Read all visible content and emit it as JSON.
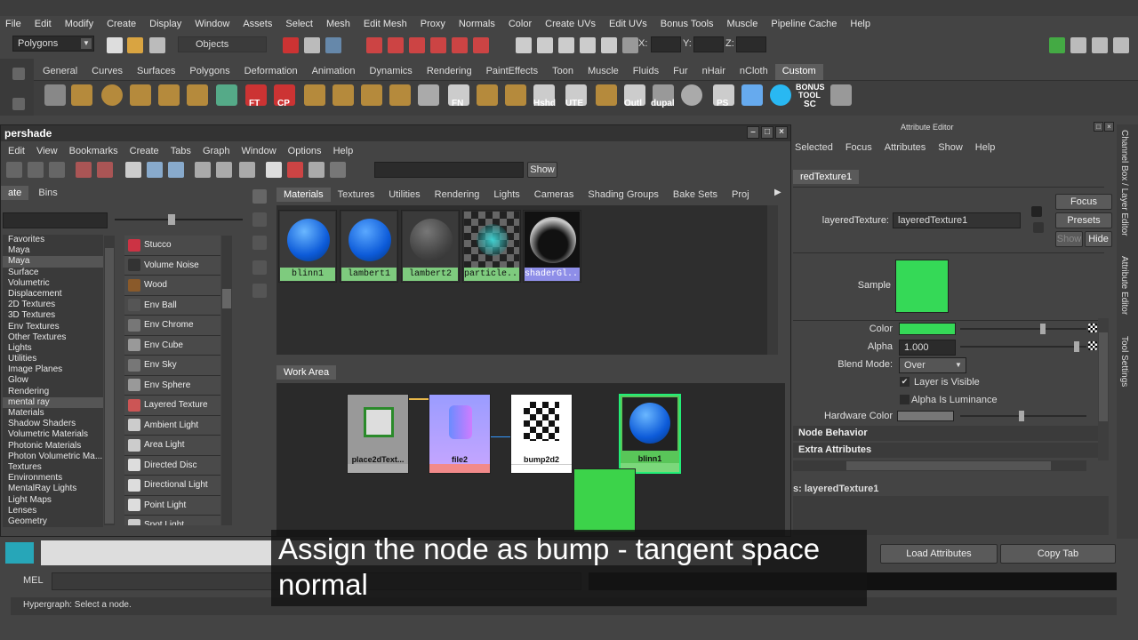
{
  "menu": [
    "File",
    "Edit",
    "Modify",
    "Create",
    "Display",
    "Window",
    "Assets",
    "Select",
    "Mesh",
    "Edit Mesh",
    "Proxy",
    "Normals",
    "Color",
    "Create UVs",
    "Edit UVs",
    "Bonus Tools",
    "Muscle",
    "Pipeline Cache",
    "Help"
  ],
  "status": {
    "mode": "Polygons",
    "objects": "Objects",
    "x_label": "X:",
    "y_label": "Y:",
    "z_label": "Z:"
  },
  "shelf_tabs": [
    "General",
    "Curves",
    "Surfaces",
    "Polygons",
    "Deformation",
    "Animation",
    "Dynamics",
    "Rendering",
    "PaintEffects",
    "Toon",
    "Muscle",
    "Fluids",
    "Fur",
    "nHair",
    "nCloth",
    "Custom"
  ],
  "shelf_active": "Custom",
  "shelf_labels": {
    "ft": "FT",
    "cp": "CP",
    "fn": "FN",
    "hshd": "Hshd",
    "ute": "UTE",
    "outl": "Outl",
    "dupal": "dupal",
    "ps": "PS",
    "bonus": "BONUS",
    "tool": "TOOL",
    "sc": "SC"
  },
  "hypershade": {
    "title": "pershade",
    "menu": [
      "Edit",
      "View",
      "Bookmarks",
      "Create",
      "Tabs",
      "Graph",
      "Window",
      "Options",
      "Help"
    ],
    "show_label": "Show",
    "left_tabs": [
      "ate",
      "Bins"
    ],
    "categories": [
      "Favorites",
      "Maya",
      "Maya",
      "Surface",
      "Volumetric",
      "Displacement",
      "2D Textures",
      "3D Textures",
      "Env Textures",
      "Other Textures",
      "Lights",
      "Utilities",
      "Image Planes",
      "Glow",
      "Rendering",
      "mental ray",
      "Materials",
      "Shadow Shaders",
      "Volumetric Materials",
      "Photonic Materials",
      "Photon Volumetric Ma...",
      "Textures",
      "Environments",
      "MentalRay Lights",
      "Light Maps",
      "Lenses",
      "Geometry"
    ],
    "nodes": [
      "Stucco",
      "Volume Noise",
      "Wood",
      "Env Ball",
      "Env Chrome",
      "Env Cube",
      "Env Sky",
      "Env Sphere",
      "Layered Texture",
      "Ambient Light",
      "Area Light",
      "Directed Disc",
      "Directional Light",
      "Point Light",
      "Spot Light"
    ],
    "tabs": [
      "Materials",
      "Textures",
      "Utilities",
      "Rendering",
      "Lights",
      "Cameras",
      "Shading Groups",
      "Bake Sets",
      "Proj"
    ],
    "active_tab": "Materials",
    "swatches": [
      "blinn1",
      "lambert1",
      "lambert2",
      "particle...",
      "shaderGl..."
    ],
    "work_area_label": "Work Area",
    "work_nodes": [
      "place2dText...",
      "file2",
      "bump2d2",
      "blinn1"
    ]
  },
  "attr_editor": {
    "title": "Attribute Editor",
    "menu": [
      "Selected",
      "Focus",
      "Attributes",
      "Show",
      "Help"
    ],
    "node_tab": "redTexture1",
    "field_label": "layeredTexture:",
    "field_value": "layeredTexture1",
    "focus_btn": "Focus",
    "presets_btn": "Presets",
    "show_btn": "Show",
    "hide_btn": "Hide",
    "sample_label": "Sample",
    "color_label": "Color",
    "alpha_label": "Alpha",
    "alpha_value": "1.000",
    "blend_label": "Blend Mode:",
    "blend_value": "Over",
    "layer_visible": "Layer is Visible",
    "alpha_luminance": "Alpha Is Luminance",
    "hw_color": "Hardware Color",
    "section1": "Node Behavior",
    "section2": "Extra Attributes",
    "notes_label": "s: layeredTexture1",
    "load_btn": "Load Attributes",
    "copy_btn": "Copy Tab",
    "swatch_color": "#35d957"
  },
  "right_tabs": [
    "Channel Box / Layer Editor",
    "Attribute Editor",
    "Tool Settings"
  ],
  "mel_label": "MEL",
  "help_line": "Hypergraph: Select a node.",
  "subtitle": "Assign the node as bump - tangent space normal"
}
